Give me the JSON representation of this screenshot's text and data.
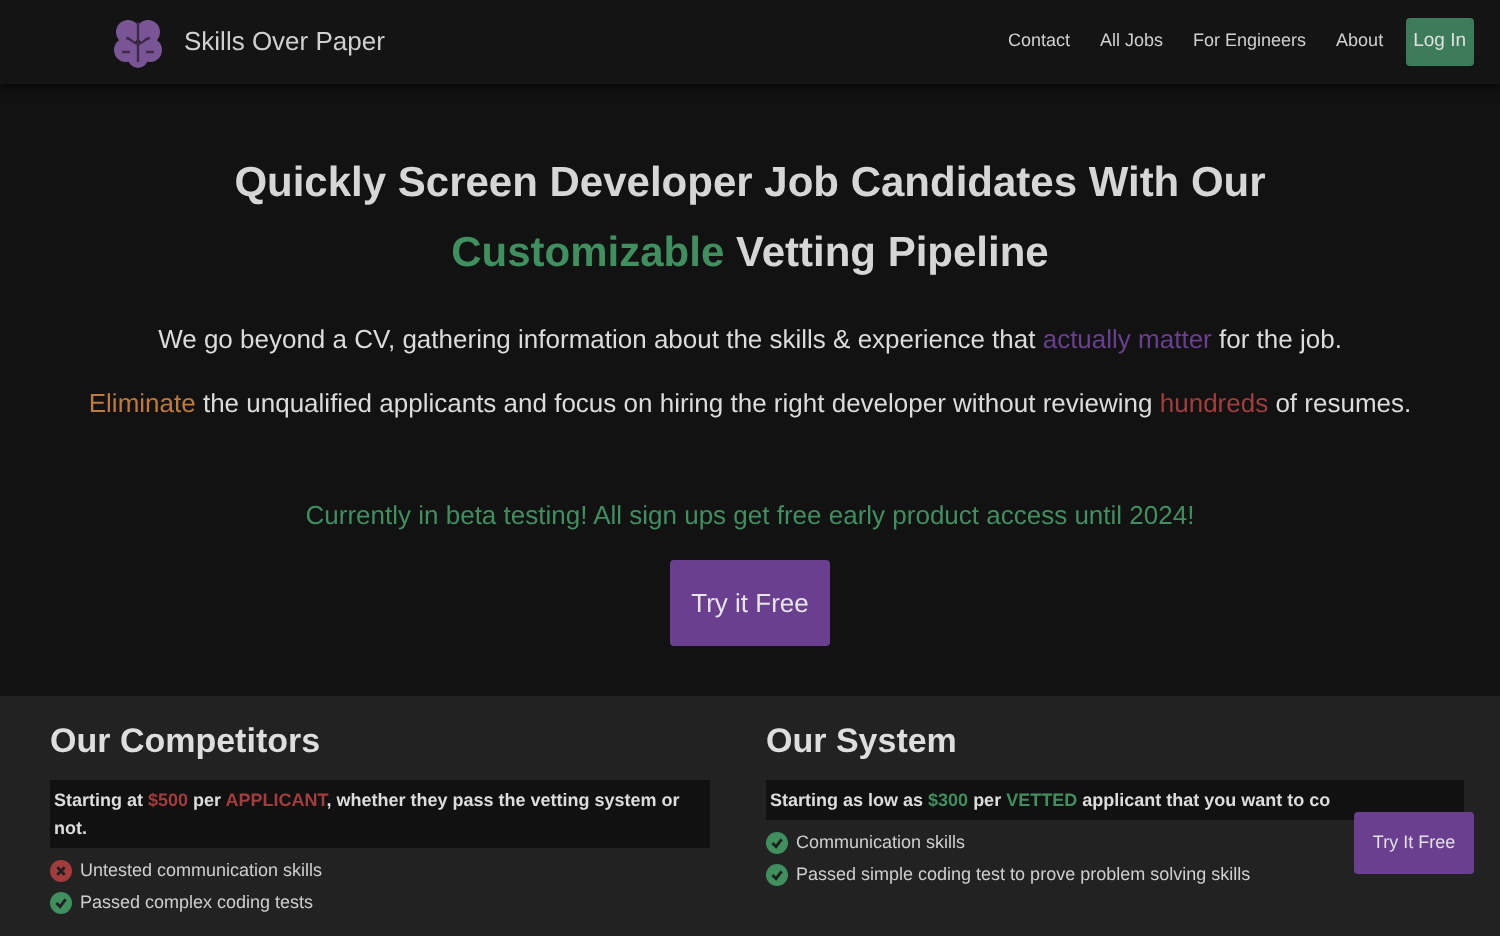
{
  "header": {
    "brand": "Skills Over Paper",
    "nav": [
      {
        "label": "Contact",
        "kind": "link"
      },
      {
        "label": "All Jobs",
        "kind": "link"
      },
      {
        "label": "For Engineers",
        "kind": "link"
      },
      {
        "label": "About",
        "kind": "link"
      },
      {
        "label": "Log In",
        "kind": "button"
      }
    ]
  },
  "hero": {
    "title_lines": [
      [
        {
          "text": "Quickly Screen Developer Job Candidates With Our"
        }
      ],
      [
        {
          "text": "Customizable",
          "color": "#3f8f5f"
        },
        {
          "text": " Vetting Pipeline"
        }
      ]
    ],
    "paragraphs": [
      [
        {
          "text": "We go beyond a CV, gathering information about the skills & experience that "
        },
        {
          "text": "actually matter",
          "color": "#6a3f8f"
        },
        {
          "text": " for the job."
        }
      ],
      [
        {
          "text": "Eliminate",
          "color": "#c07a3a"
        },
        {
          "text": " the unqualified applicants and focus on hiring the right developer without reviewing "
        },
        {
          "text": "hundreds",
          "color": "#a33c3c"
        },
        {
          "text": " of resumes."
        }
      ]
    ],
    "notice": "Currently in beta testing! All sign ups get free early product access until 2024!",
    "cta": "Try it Free"
  },
  "comparison": [
    {
      "heading": "Our Competitors",
      "price": [
        {
          "text": "Starting at "
        },
        {
          "text": "$500",
          "color": "#a33c3c"
        },
        {
          "text": " per "
        },
        {
          "text": "APPLICANT",
          "color": "#a33c3c"
        },
        {
          "text": ", whether they pass the vetting system or not."
        }
      ],
      "items": [
        {
          "text": "Untested communication skills",
          "kind": "bad"
        },
        {
          "text": "Passed complex coding tests",
          "kind": "good"
        }
      ]
    },
    {
      "heading": "Our System",
      "price": [
        {
          "text": "Starting as low as "
        },
        {
          "text": "$300",
          "color": "#3f8f5f"
        },
        {
          "text": " per "
        },
        {
          "text": "VETTED",
          "color": "#3f8f5f"
        },
        {
          "text": " applicant that you want to co"
        }
      ],
      "items": [
        {
          "text": "Communication skills",
          "kind": "good"
        },
        {
          "text": "Passed simple coding test to prove problem solving skills",
          "kind": "good"
        }
      ]
    }
  ],
  "floating_button": "Try It Free"
}
